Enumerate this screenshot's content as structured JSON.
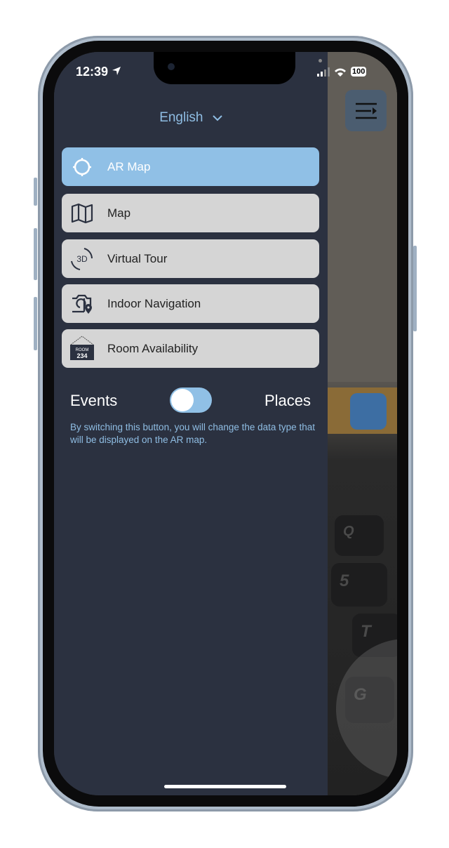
{
  "status_bar": {
    "time": "12:39",
    "battery": "100",
    "icons": [
      "location-arrow-icon",
      "signal-icon",
      "wifi-icon",
      "battery-icon"
    ]
  },
  "language": {
    "selected": "English",
    "icon": "chevron-down-icon"
  },
  "menu": {
    "items": [
      {
        "label": "AR Map",
        "icon": "crosshair-icon",
        "active": true
      },
      {
        "label": "Map",
        "icon": "map-icon",
        "active": false
      },
      {
        "label": "Virtual Tour",
        "icon": "rotate-3d-icon",
        "icon_text": "3D",
        "active": false
      },
      {
        "label": "Indoor Navigation",
        "icon": "camera-location-icon",
        "active": false
      },
      {
        "label": "Room Availability",
        "icon": "room-sign-icon",
        "icon_text": "ROOM 234",
        "active": false
      }
    ]
  },
  "toggle": {
    "left_label": "Events",
    "right_label": "Places",
    "selected": "Events",
    "description": "By switching this button, you will change the data type that will be displayed on the AR map."
  },
  "background": {
    "keys": [
      "Q",
      "5",
      "T",
      "G"
    ]
  },
  "colors": {
    "drawer": "#2b3140",
    "accent": "#90c0e6",
    "item": "#d5d5d5"
  }
}
